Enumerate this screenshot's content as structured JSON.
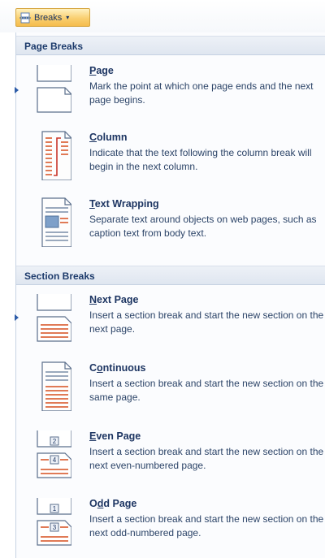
{
  "ribbon": {
    "breaks_button": {
      "label": "Breaks",
      "icon": "page-breaks-icon"
    }
  },
  "menu": {
    "page_breaks": {
      "header": "Page Breaks",
      "items": [
        {
          "title": "Page",
          "accel": "P",
          "rest": "age",
          "description": "Mark the point at which one page ends and the next page begins.",
          "icon": "page-break-icon"
        },
        {
          "title": "Column",
          "accel": "C",
          "rest": "olumn",
          "description": "Indicate that the text following the column break will begin in the next column.",
          "icon": "column-break-icon"
        },
        {
          "title": "Text Wrapping",
          "accel": "T",
          "rest": "ext Wrapping",
          "description": "Separate text around objects on web pages, such as caption text from body text.",
          "icon": "text-wrapping-icon"
        }
      ]
    },
    "section_breaks": {
      "header": "Section Breaks",
      "items": [
        {
          "title": "Next Page",
          "accel": "N",
          "rest": "ext Page",
          "description": "Insert a section break and start the new section on the next page.",
          "icon": "next-page-icon"
        },
        {
          "title": "Continuous",
          "accel": "O",
          "rest": "ntinuous",
          "prefix": "C",
          "description": "Insert a section break and start the new section on the same page.",
          "icon": "continuous-icon"
        },
        {
          "title": "Even Page",
          "accel": "E",
          "rest": "ven Page",
          "description": "Insert a section break and start the new section on the next even-numbered page.",
          "icon": "even-page-icon",
          "page_numbers": [
            "2",
            "4"
          ]
        },
        {
          "title": "Odd Page",
          "accel": "D",
          "rest": "d Page",
          "prefix": "O",
          "description": "Insert a section break and start the new section on the next odd-numbered page.",
          "icon": "odd-page-icon",
          "page_numbers": [
            "1",
            "3"
          ]
        }
      ]
    }
  },
  "colors": {
    "accent": "#2d5ca8",
    "header_text": "#1c3a6b",
    "button_gold": "#f9cf70",
    "section_orange": "#d9623a"
  }
}
